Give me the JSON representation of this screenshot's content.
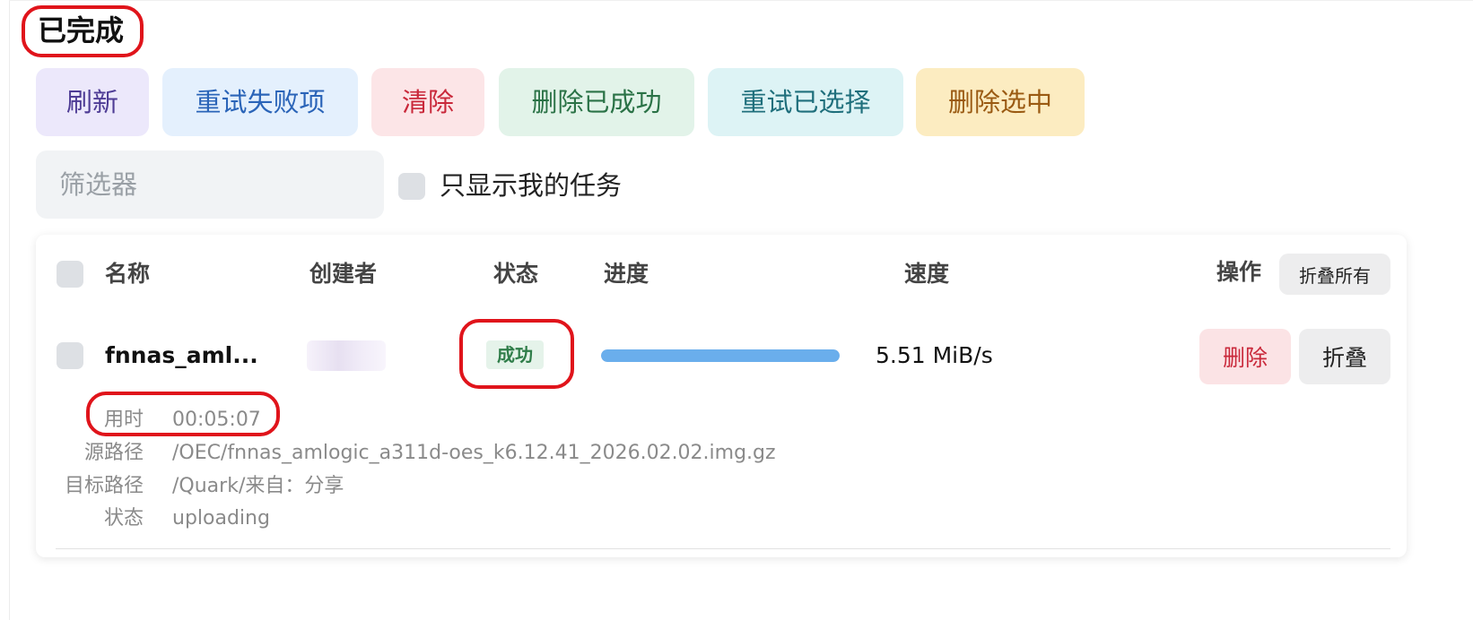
{
  "section": {
    "title": "已完成"
  },
  "toolbar": {
    "buttons": [
      {
        "label": "刷新",
        "bg": "#ece8fb",
        "fg": "#4e3c95"
      },
      {
        "label": "重试失败项",
        "bg": "#e4f0fd",
        "fg": "#2a64b8"
      },
      {
        "label": "清除",
        "bg": "#fce5e7",
        "fg": "#c9283a"
      },
      {
        "label": "删除已成功",
        "bg": "#e2f3e9",
        "fg": "#2a7246"
      },
      {
        "label": "重试已选择",
        "bg": "#ddf3f5",
        "fg": "#1f6f7c"
      },
      {
        "label": "删除选中",
        "bg": "#fcecc1",
        "fg": "#9a5a12"
      }
    ]
  },
  "filter": {
    "placeholder": "筛选器",
    "value": ""
  },
  "only_mine": {
    "label": "只显示我的任务",
    "checked": false
  },
  "table": {
    "headers": {
      "name": "名称",
      "creator": "创建者",
      "status": "状态",
      "progress": "进度",
      "speed": "速度",
      "actions": "操作"
    },
    "collapse_all_label": "折叠所有",
    "rows": [
      {
        "name": "fnnas_aml...",
        "status": "成功",
        "progress_fraction": 1.0,
        "speed": "5.51 MiB/s",
        "delete_label": "删除",
        "collapse_label": "折叠",
        "details": [
          {
            "key": "用时",
            "value": "00:05:07"
          },
          {
            "key": "源路径",
            "value": "/OEC/fnnas_amlogic_a311d-oes_k6.12.41_2026.02.02.img.gz"
          },
          {
            "key": "目标路径",
            "value": "/Quark/来自：分享"
          },
          {
            "key": "状态",
            "value": "uploading"
          }
        ]
      }
    ]
  },
  "colors": {
    "highlight": "#e0141b",
    "success_bg": "#e5f3ea",
    "success_fg": "#2f7d49",
    "progress": "#6aaeec"
  }
}
